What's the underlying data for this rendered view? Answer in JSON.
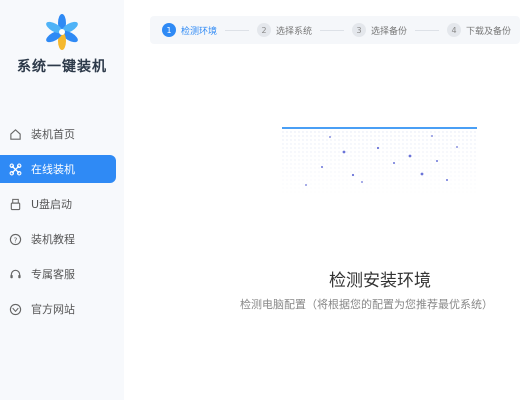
{
  "app": {
    "logo_text": "系统一键装机"
  },
  "sidebar": {
    "items": [
      {
        "label": "装机首页",
        "icon": "home-icon",
        "active": false
      },
      {
        "label": "在线装机",
        "icon": "link-icon",
        "active": true
      },
      {
        "label": "U盘启动",
        "icon": "usb-icon",
        "active": false
      },
      {
        "label": "装机教程",
        "icon": "help-circle-icon",
        "active": false
      },
      {
        "label": "专属客服",
        "icon": "headset-icon",
        "active": false
      },
      {
        "label": "官方网站",
        "icon": "globe-icon",
        "active": false
      }
    ]
  },
  "stepper": {
    "steps": [
      {
        "num": "1",
        "label": "检测环境",
        "active": true
      },
      {
        "num": "2",
        "label": "选择系统",
        "active": false
      },
      {
        "num": "3",
        "label": "选择备份",
        "active": false
      },
      {
        "num": "4",
        "label": "下载及备份",
        "active": false
      }
    ]
  },
  "main": {
    "title": "检测安装环境",
    "subtitle": "检测电脑配置（将根据您的配置为您推荐最优系统）"
  },
  "colors": {
    "accent": "#2f8af5",
    "sidebar_bg": "#f7f9fc"
  }
}
